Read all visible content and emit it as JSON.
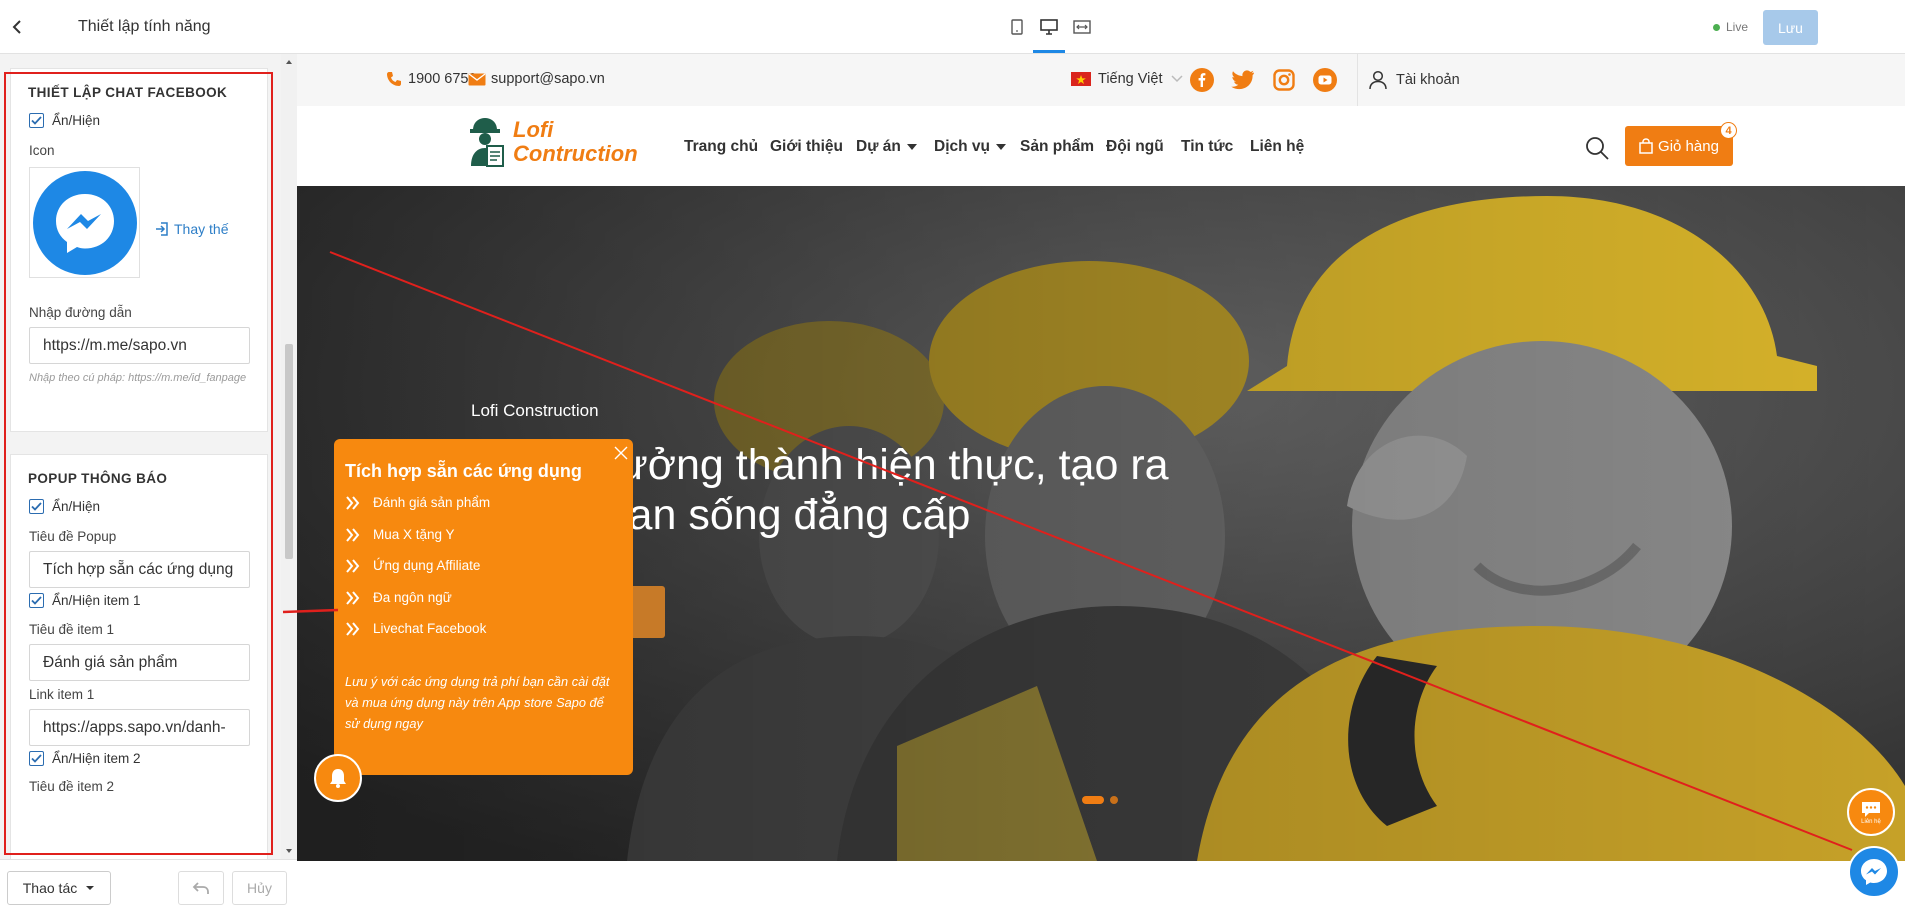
{
  "panel": {
    "title": "Thiết lập tính năng",
    "facebook": {
      "section_title": "THIẾT LẬP CHAT FACEBOOK",
      "show_label": "Ẩn/Hiện",
      "icon_label": "Icon",
      "replace_label": "Thay thế",
      "link_label": "Nhập đường dẫn",
      "link_value": "https://m.me/sapo.vn",
      "hint": "Nhập theo cú pháp: https://m.me/id_fanpage"
    },
    "popup": {
      "section_title": "POPUP THÔNG BÁO",
      "show_label": "Ẩn/Hiện",
      "title_label": "Tiêu đề Popup",
      "title_value": "Tích hợp sẵn các ứng dụng",
      "item1_show": "Ẩn/Hiện item 1",
      "item1_title_label": "Tiêu đề item 1",
      "item1_title_value": "Đánh giá sản phẩm",
      "item1_link_label": "Link item 1",
      "item1_link_value": "https://apps.sapo.vn/danh-",
      "item2_show": "Ẩn/Hiện item 2",
      "item2_title_label": "Tiêu đề item 2"
    },
    "footer": {
      "actions_label": "Thao tác",
      "cancel_label": "Hủy"
    }
  },
  "editor": {
    "live_label": "Live",
    "save_label": "Lưu"
  },
  "site": {
    "phone": "1900 6750",
    "email": "support@sapo.vn",
    "language": "Tiếng Việt",
    "account": "Tài khoản",
    "logo_line1": "Lofi",
    "logo_line2": "Contruction",
    "nav": [
      "Trang chủ",
      "Giới thiệu",
      "Dự án",
      "Dịch vụ",
      "Sản phẩm",
      "Đội ngũ",
      "Tin tức",
      "Liên hệ"
    ],
    "cart_label": "Giỏ hàng",
    "cart_count": "4",
    "hero": {
      "subtitle": "Lofi Construction",
      "line1": "ưởng thành hiện thực, tạo ra",
      "line2": "ian sống đẳng cấp"
    },
    "contact_label": "Liên hệ"
  },
  "popup_widget": {
    "title": "Tích hợp sẵn các ứng dụng",
    "items": [
      "Đánh giá sản phẩm",
      "Mua X tặng Y",
      "Ứng dụng Affiliate",
      "Đa ngôn ngữ",
      "Livechat Facebook"
    ],
    "note": "Lưu ý với các ứng dụng trả phí bạn cần cài đặt và mua ứng dụng này trên App store Sapo để sử dụng ngay"
  },
  "colors": {
    "accent_orange": "#f7890f",
    "brand_orange": "#f07d13",
    "messenger_blue": "#1e88e5",
    "annotation_red": "#e0201c",
    "save_disabled": "#a7c9ea"
  },
  "icons": [
    "chevron-left-icon",
    "check-icon",
    "messenger-icon",
    "replace-icon",
    "mobile-icon",
    "desktop-icon",
    "fullwidth-icon",
    "phone-icon",
    "mail-icon",
    "flag-vietnam-icon",
    "chevron-down-icon",
    "facebook-icon",
    "twitter-icon",
    "instagram-icon",
    "youtube-icon",
    "user-icon",
    "search-icon",
    "bag-icon",
    "close-icon",
    "double-chevron-icon",
    "bell-icon",
    "chat-icon",
    "undo-icon",
    "caret-down-icon"
  ]
}
